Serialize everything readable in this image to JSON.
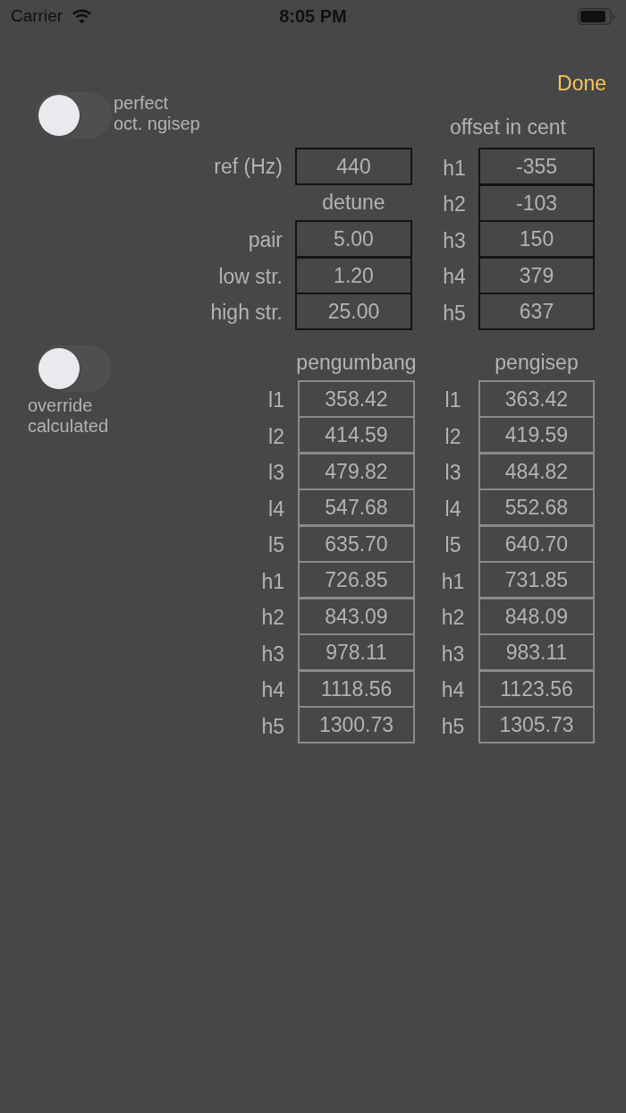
{
  "status_bar": {
    "carrier": "Carrier",
    "time": "8:05 PM"
  },
  "nav": {
    "done": "Done"
  },
  "perfect_octave_toggle": {
    "label": "perfect\noct. ngisep",
    "on": false
  },
  "tuning": {
    "ref": {
      "label": "ref (Hz)",
      "value": "440"
    },
    "detune_header": "detune",
    "detune": [
      {
        "label": "pair",
        "value": "5.00"
      },
      {
        "label": "low str.",
        "value": "1.20"
      },
      {
        "label": "high str.",
        "value": "25.00"
      }
    ],
    "offset_header": "offset in cent",
    "offsets": [
      {
        "label": "h1",
        "value": "-355"
      },
      {
        "label": "h2",
        "value": "-103"
      },
      {
        "label": "h3",
        "value": "150"
      },
      {
        "label": "h4",
        "value": "379"
      },
      {
        "label": "h5",
        "value": "637"
      }
    ]
  },
  "override_toggle": {
    "label": "override\ncalculated",
    "on": false
  },
  "calculated": {
    "disabled": true,
    "columns": [
      {
        "header": "pengumbang",
        "rows": [
          {
            "label": "l1",
            "value": "358.42"
          },
          {
            "label": "l2",
            "value": "414.59"
          },
          {
            "label": "l3",
            "value": "479.82"
          },
          {
            "label": "l4",
            "value": "547.68"
          },
          {
            "label": "l5",
            "value": "635.70"
          },
          {
            "label": "h1",
            "value": "726.85"
          },
          {
            "label": "h2",
            "value": "843.09"
          },
          {
            "label": "h3",
            "value": "978.11"
          },
          {
            "label": "h4",
            "value": "1118.56"
          },
          {
            "label": "h5",
            "value": "1300.73"
          }
        ]
      },
      {
        "header": "pengisep",
        "rows": [
          {
            "label": "l1",
            "value": "363.42"
          },
          {
            "label": "l2",
            "value": "419.59"
          },
          {
            "label": "l3",
            "value": "484.82"
          },
          {
            "label": "l4",
            "value": "552.68"
          },
          {
            "label": "l5",
            "value": "640.70"
          },
          {
            "label": "h1",
            "value": "731.85"
          },
          {
            "label": "h2",
            "value": "848.09"
          },
          {
            "label": "h3",
            "value": "983.11"
          },
          {
            "label": "h4",
            "value": "1123.56"
          },
          {
            "label": "h5",
            "value": "1305.73"
          }
        ]
      }
    ]
  }
}
